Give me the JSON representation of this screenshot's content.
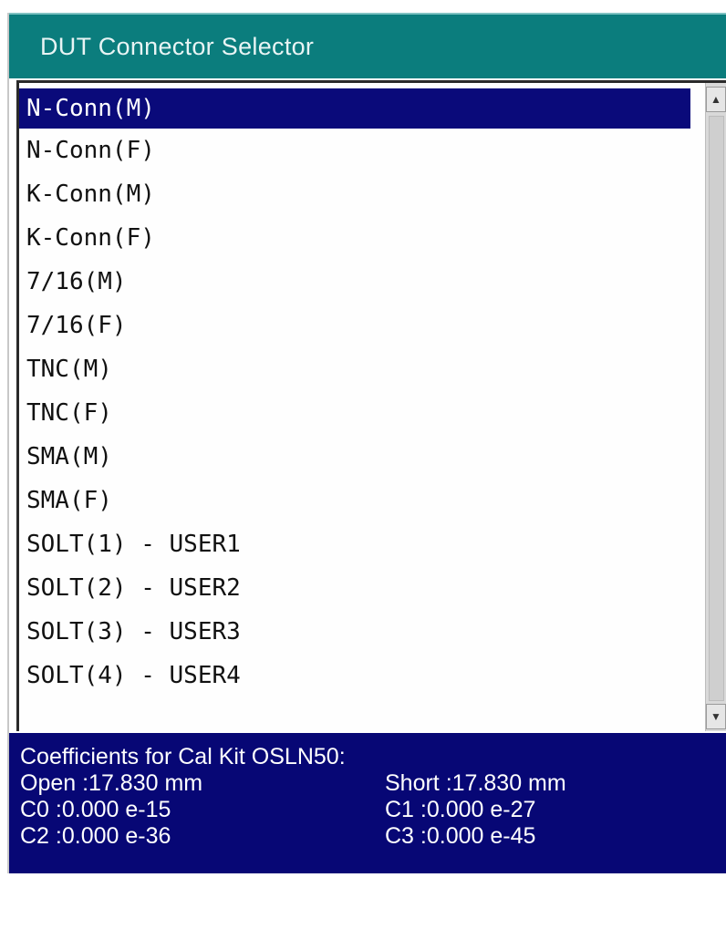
{
  "window": {
    "title": "DUT Connector Selector"
  },
  "list": {
    "items": [
      "N-Conn(M)",
      "N-Conn(F)",
      "K-Conn(M)",
      "K-Conn(F)",
      "7/16(M)",
      "7/16(F)",
      "TNC(M)",
      "TNC(F)",
      "SMA(M)",
      "SMA(F)",
      "SOLT(1) - USER1",
      "SOLT(2) - USER2",
      "SOLT(3) - USER3",
      "SOLT(4) - USER4"
    ],
    "selected_index": 0
  },
  "scrollbar": {
    "up_icon": "arrow-up-icon",
    "down_icon": "arrow-down-icon"
  },
  "info": {
    "heading": "Coefficients for Cal Kit OSLN50:",
    "open": "Open :17.830 mm",
    "short": "Short :17.830 mm",
    "c0": "C0 :0.000 e-15",
    "c1": "C1 :0.000 e-27",
    "c2": "C2 :0.000 e-36",
    "c3": "C3 :0.000 e-45"
  },
  "colors": {
    "title_bar": "#0b7d7d",
    "selection": "#0a0a7a",
    "info_panel": "#070775"
  }
}
